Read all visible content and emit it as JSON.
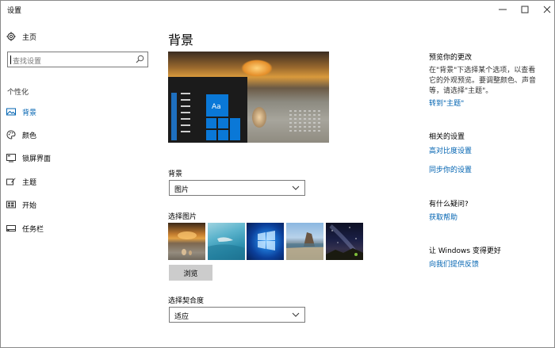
{
  "window": {
    "title": "设置"
  },
  "sidebar": {
    "home_label": "主页",
    "search_placeholder": "查找设置",
    "section_label": "个性化",
    "items": [
      {
        "label": "背景",
        "icon": "image-icon",
        "active": true
      },
      {
        "label": "颜色",
        "icon": "palette-icon",
        "active": false
      },
      {
        "label": "锁屏界面",
        "icon": "lock-screen-icon",
        "active": false
      },
      {
        "label": "主题",
        "icon": "theme-icon",
        "active": false
      },
      {
        "label": "开始",
        "icon": "start-icon",
        "active": false
      },
      {
        "label": "任务栏",
        "icon": "taskbar-icon",
        "active": false
      }
    ]
  },
  "main": {
    "title": "背景",
    "preview": {
      "tile_text": "Aa"
    },
    "background": {
      "label": "背景",
      "value": "图片"
    },
    "choose_picture": {
      "label": "选择图片",
      "browse_label": "浏览"
    },
    "fit": {
      "label": "选择契合度",
      "value": "适应"
    }
  },
  "right": {
    "preview_changes": {
      "heading": "预览你的更改",
      "text": "在\"背景\"下选择某个选项，以查看它的外观预览。要调整颜色、声音等，请选择\"主题\"。",
      "link": "转到\"主题\""
    },
    "related": {
      "heading": "相关的设置",
      "links": [
        "高对比度设置",
        "同步你的设置"
      ]
    },
    "question": {
      "heading": "有什么疑问?",
      "link": "获取帮助"
    },
    "improve": {
      "heading": "让 Windows 变得更好",
      "link": "向我们提供反馈"
    }
  },
  "colors": {
    "accent": "#0063b1",
    "tile_blue": "#0a78d7",
    "button_gray": "#cccccc"
  }
}
